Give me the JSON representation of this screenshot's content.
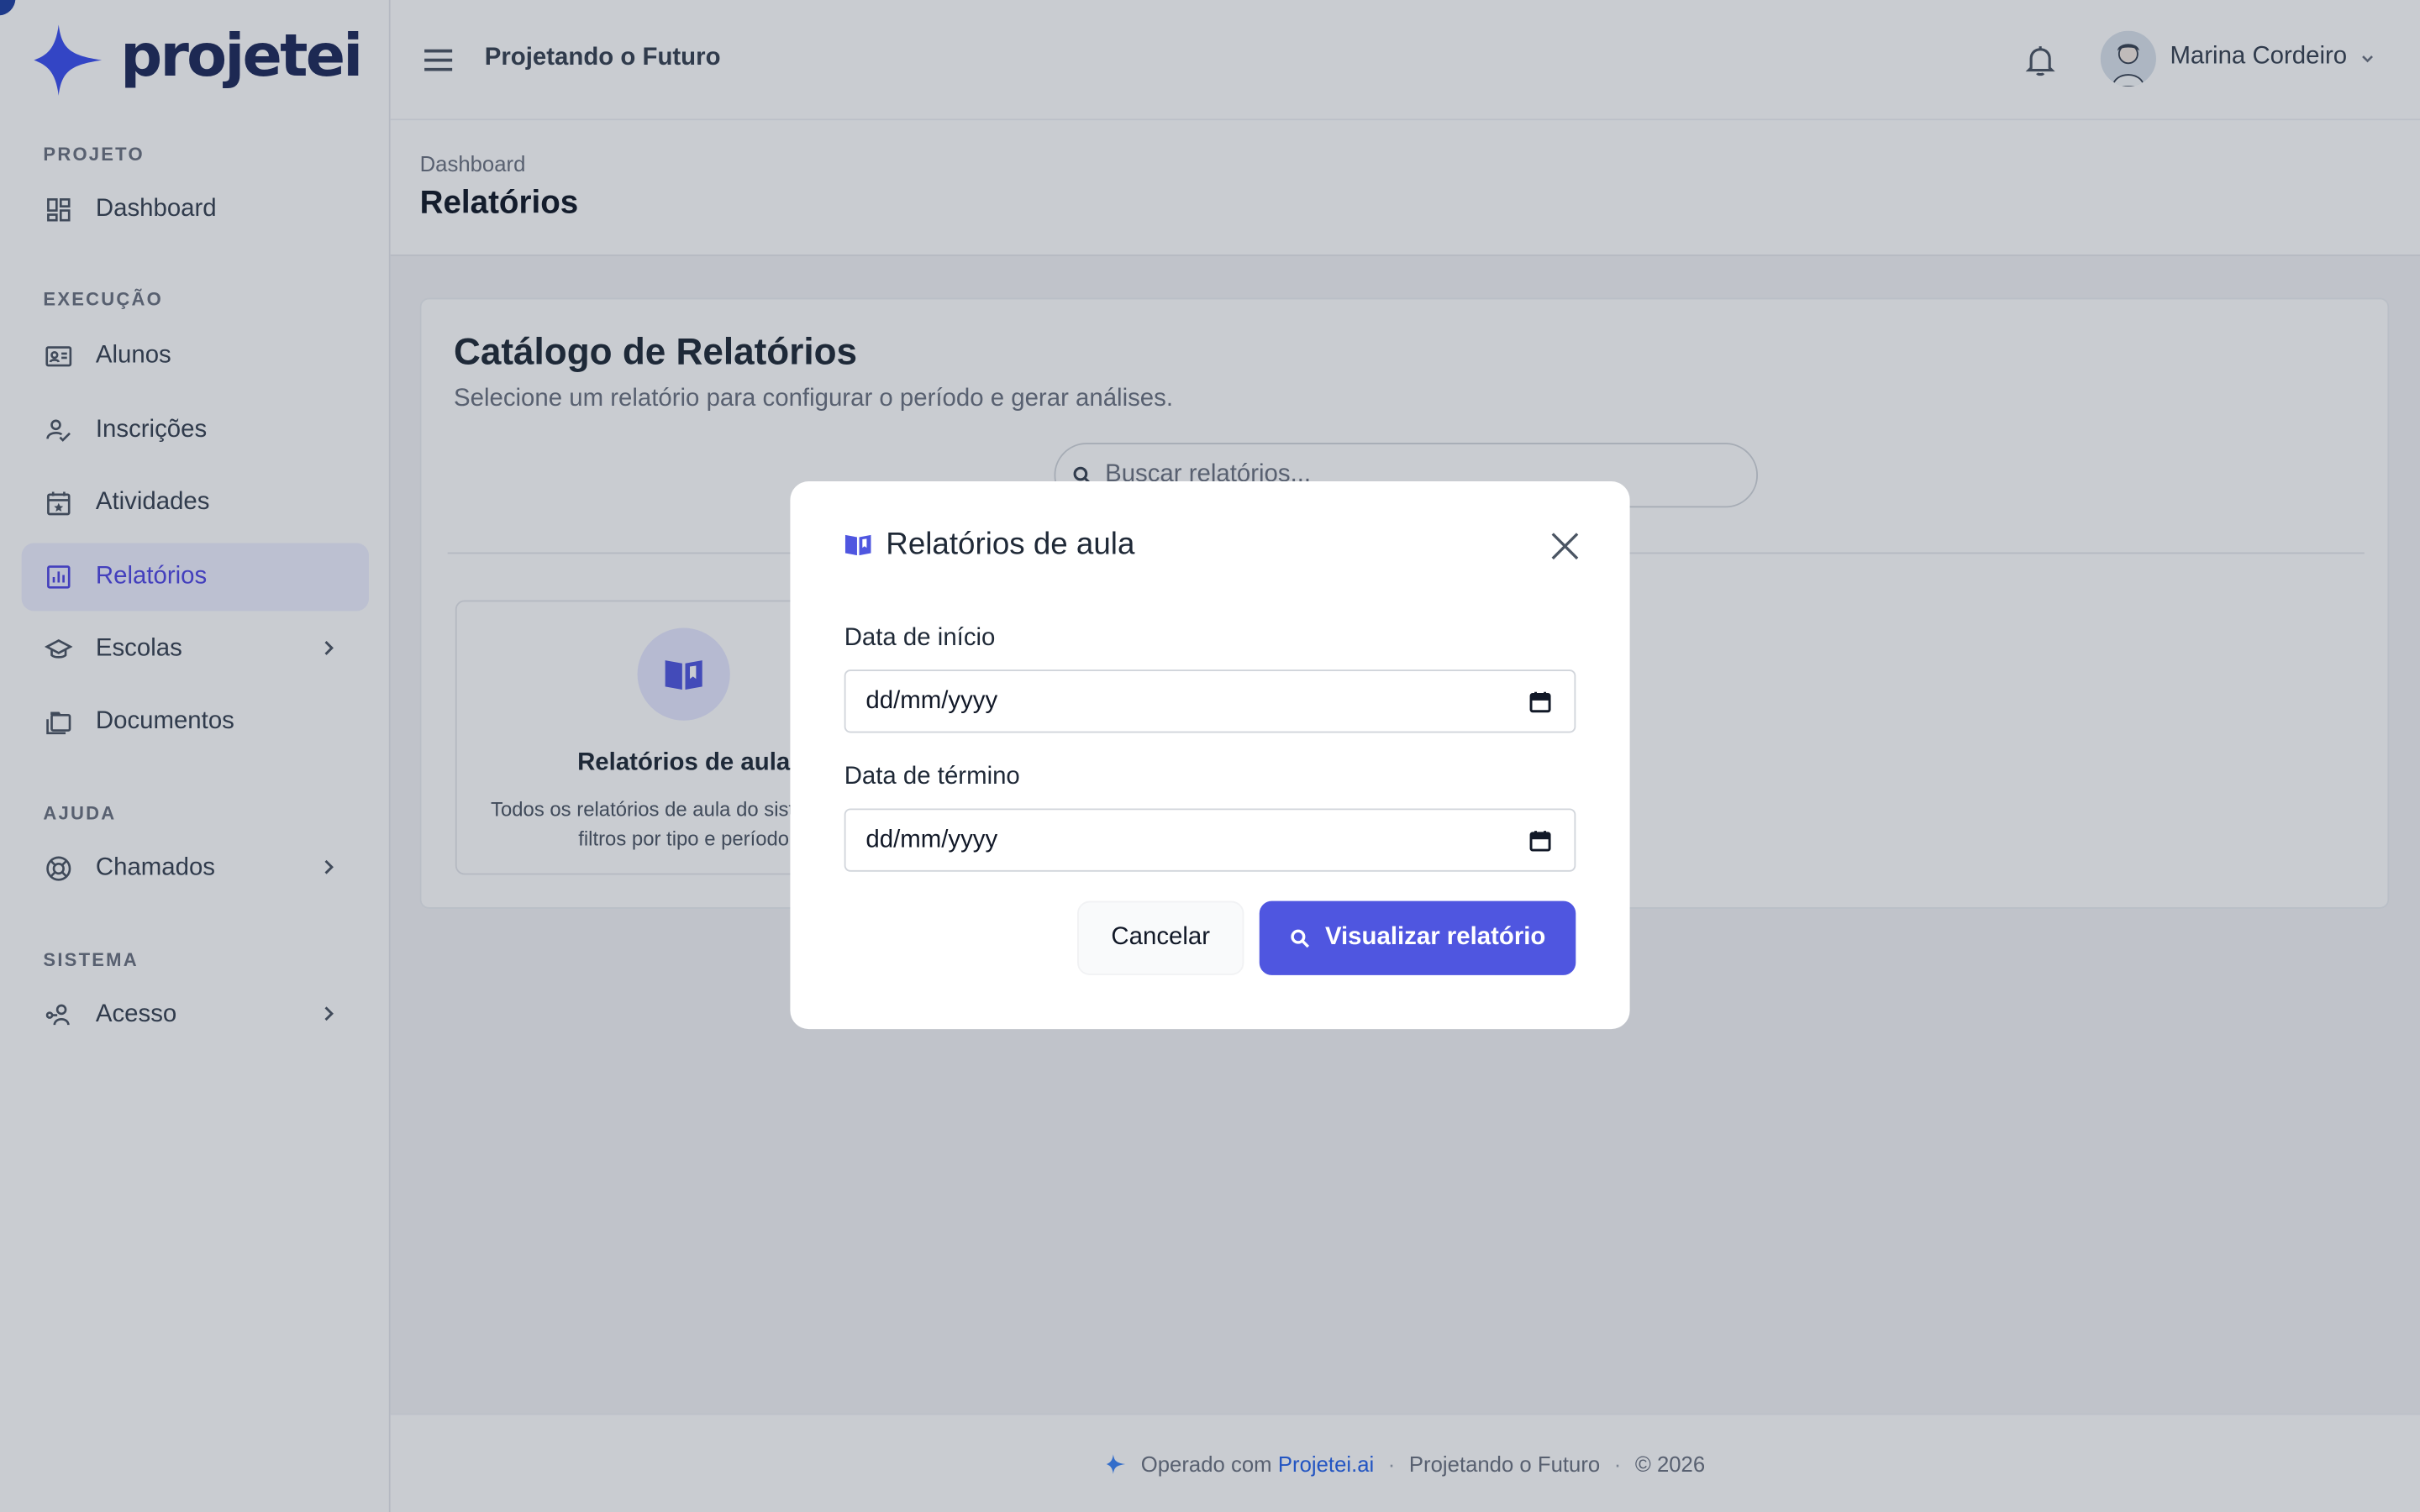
{
  "app": {
    "logo_text": "projetei",
    "project_name": "Projetando o Futuro"
  },
  "colors": {
    "accent": "#4f56e0",
    "active_bg": "#eef0ff",
    "brand_dark": "#1e2a5a",
    "link": "#2563eb"
  },
  "sidebar": {
    "sections": [
      {
        "title": "PROJETO"
      },
      {
        "title": "EXECUÇÃO"
      },
      {
        "title": "AJUDA"
      },
      {
        "title": "SISTEMA"
      }
    ],
    "items": [
      {
        "label": "Dashboard",
        "icon": "dashboard-icon"
      },
      {
        "label": "Alunos",
        "icon": "id-card-icon"
      },
      {
        "label": "Inscrições",
        "icon": "user-check-icon"
      },
      {
        "label": "Atividades",
        "icon": "calendar-star-icon"
      },
      {
        "label": "Relatórios",
        "icon": "bar-chart-icon",
        "active": true
      },
      {
        "label": "Escolas",
        "icon": "school-icon",
        "has_children": true
      },
      {
        "label": "Documentos",
        "icon": "folders-icon"
      },
      {
        "label": "Chamados",
        "icon": "lifebuoy-icon",
        "has_children": true
      },
      {
        "label": "Acesso",
        "icon": "user-key-icon",
        "has_children": true
      }
    ]
  },
  "header": {
    "user_name": "Marina Cordeiro",
    "notifications_icon": "bell-icon"
  },
  "page": {
    "breadcrumb": "Dashboard",
    "title": "Relatórios"
  },
  "catalog": {
    "title": "Catálogo de Relatórios",
    "subtitle": "Selecione um relatório para configurar o período e gerar análises.",
    "search_placeholder": "Buscar relatórios...",
    "reports": [
      {
        "title": "Relatórios de aula",
        "description": "Todos os relatórios de aula do sistema com filtros por tipo e período",
        "icon": "book-open-icon"
      }
    ]
  },
  "modal": {
    "title": "Relatórios de aula",
    "start_label": "Data de início",
    "start_value": "dd/mm/yyyy",
    "end_label": "Data de término",
    "end_value": "dd/mm/yyyy",
    "cancel_label": "Cancelar",
    "submit_label": "Visualizar relatório"
  },
  "footer": {
    "prefix": "Operado com",
    "brand": "Projetei.ai",
    "project": "Projetando o Futuro",
    "copyright": "© 2026"
  }
}
